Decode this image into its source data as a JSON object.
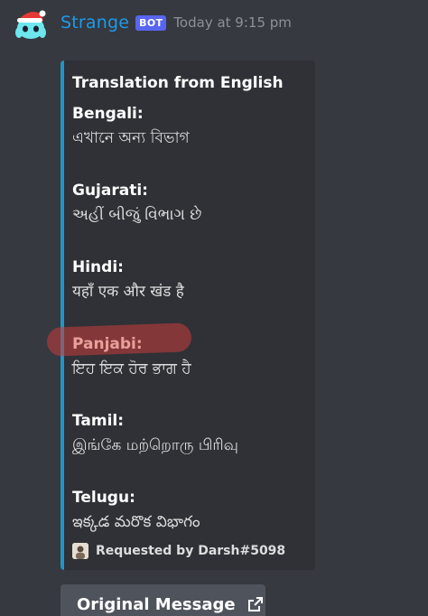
{
  "message": {
    "username": "Strange",
    "bot_tag": "BOT",
    "timestamp": "Today at 9:15 pm"
  },
  "embed": {
    "title": "Translation from English",
    "accent_color": "#2196c5",
    "fields": [
      {
        "name": "Bengali:",
        "value": "এখানে অন্য বিভাগ"
      },
      {
        "name": "Gujarati:",
        "value": "અહીં બીજું વિભાગ છે"
      },
      {
        "name": "Hindi:",
        "value": "यहाँ एक और खंड है"
      },
      {
        "name": "Panjabi:",
        "value": "ਇਹ ਇਕ ਹੋਰ ਭਾਗ ਹੈ"
      },
      {
        "name": "Tamil:",
        "value": "இங்கே மற்றொரு பிரிவு"
      },
      {
        "name": "Telugu:",
        "value": "ఇక్కడ మరొక విభాగం"
      }
    ],
    "footer": {
      "text": "Requested by Darsh#5098",
      "icon": "user-avatar-icon"
    }
  },
  "button": {
    "label": "Original Message",
    "icon": "external-link-icon"
  },
  "colors": {
    "background": "#36393f",
    "embed_background": "#2f3136",
    "username": "#1e9ae9",
    "bot_tag": "#5865f2",
    "button": "#4f545c"
  }
}
